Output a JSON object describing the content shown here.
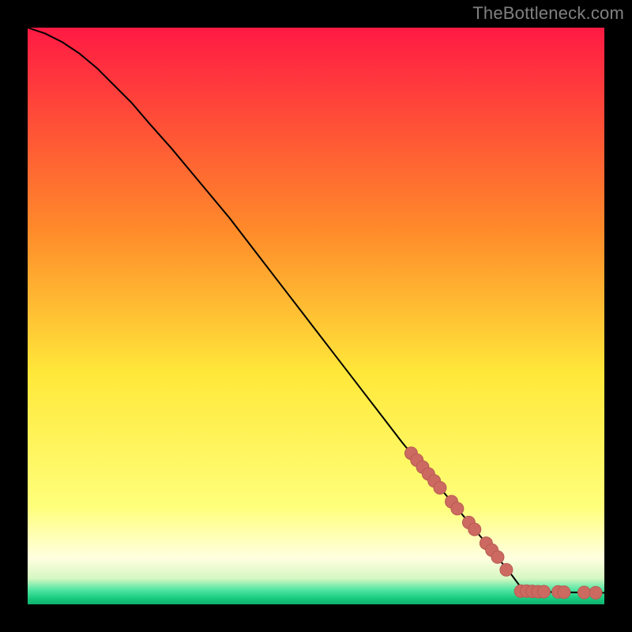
{
  "watermark": "TheBottleneck.com",
  "chart_data": {
    "type": "line",
    "title": "",
    "xlabel": "",
    "ylabel": "",
    "xlim": [
      0,
      100
    ],
    "ylim": [
      0,
      100
    ],
    "background_gradient": {
      "stops": [
        {
          "offset": 0.0,
          "color": "#ff1a44"
        },
        {
          "offset": 0.35,
          "color": "#ff8a2a"
        },
        {
          "offset": 0.6,
          "color": "#ffe83a"
        },
        {
          "offset": 0.83,
          "color": "#ffff7a"
        },
        {
          "offset": 0.92,
          "color": "#ffffe0"
        },
        {
          "offset": 0.955,
          "color": "#d6f7c2"
        },
        {
          "offset": 0.975,
          "color": "#4fe6a2"
        },
        {
          "offset": 0.99,
          "color": "#18c97e"
        },
        {
          "offset": 1.0,
          "color": "#0fb06c"
        }
      ]
    },
    "curve": {
      "comment": "Main black curve; x from 0–100, y from 0–100. Starts top-left with a gentle bulge then roughly linear to ~ (86,2), then flat along y≈2 to x=100.",
      "points": [
        [
          0,
          100
        ],
        [
          3,
          99
        ],
        [
          6,
          97.5
        ],
        [
          9,
          95.5
        ],
        [
          12,
          93
        ],
        [
          15,
          90
        ],
        [
          18,
          87
        ],
        [
          21,
          83.5
        ],
        [
          25,
          79
        ],
        [
          30,
          73
        ],
        [
          35,
          67
        ],
        [
          40,
          60.5
        ],
        [
          45,
          54
        ],
        [
          50,
          47.5
        ],
        [
          55,
          41
        ],
        [
          60,
          34.5
        ],
        [
          65,
          28
        ],
        [
          70,
          22
        ],
        [
          75,
          16
        ],
        [
          80,
          10
        ],
        [
          84,
          5
        ],
        [
          86,
          2.3
        ],
        [
          88,
          2.2
        ],
        [
          92,
          2.1
        ],
        [
          96,
          2.05
        ],
        [
          100,
          2.0
        ]
      ]
    },
    "markers": {
      "comment": "Salmon round markers clustered on lower-right portion of curve and along the flat bottom.",
      "color_fill": "#cc6a61",
      "color_stroke": "#b85b52",
      "radius": 8,
      "points": [
        [
          66.5,
          26.2
        ],
        [
          67.5,
          25.0
        ],
        [
          68.5,
          23.8
        ],
        [
          69.5,
          22.6
        ],
        [
          70.5,
          21.4
        ],
        [
          71.5,
          20.2
        ],
        [
          73.5,
          17.8
        ],
        [
          74.5,
          16.6
        ],
        [
          76.5,
          14.2
        ],
        [
          77.5,
          13.0
        ],
        [
          79.5,
          10.6
        ],
        [
          80.5,
          9.4
        ],
        [
          81.5,
          8.2
        ],
        [
          83.0,
          6.0
        ],
        [
          85.5,
          2.3
        ],
        [
          86.5,
          2.3
        ],
        [
          87.5,
          2.25
        ],
        [
          88.5,
          2.2
        ],
        [
          89.5,
          2.2
        ],
        [
          92.0,
          2.15
        ],
        [
          93.0,
          2.1
        ],
        [
          96.5,
          2.05
        ],
        [
          98.5,
          2.0
        ]
      ]
    }
  }
}
